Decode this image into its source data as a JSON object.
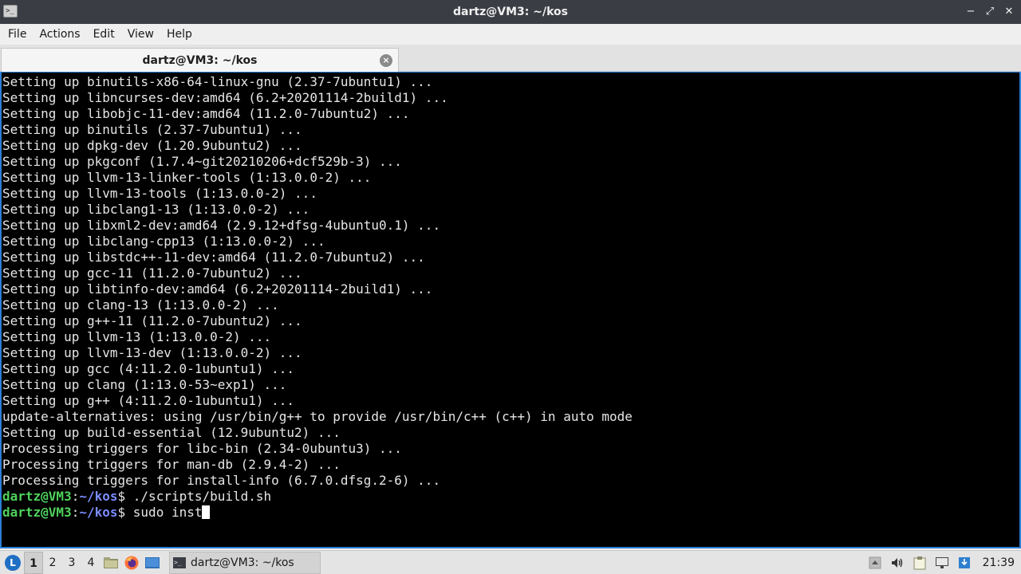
{
  "window": {
    "title": "dartz@VM3: ~/kos",
    "minimize_glyph": "−",
    "maximize_glyph": "⤢",
    "close_glyph": "✕"
  },
  "menu": [
    "File",
    "Actions",
    "Edit",
    "View",
    "Help"
  ],
  "tab": {
    "label": "dartz@VM3: ~/kos",
    "close_glyph": "×"
  },
  "terminal": {
    "output_lines": [
      "Setting up binutils-x86-64-linux-gnu (2.37-7ubuntu1) ...",
      "Setting up libncurses-dev:amd64 (6.2+20201114-2build1) ...",
      "Setting up libobjc-11-dev:amd64 (11.2.0-7ubuntu2) ...",
      "Setting up binutils (2.37-7ubuntu1) ...",
      "Setting up dpkg-dev (1.20.9ubuntu2) ...",
      "Setting up pkgconf (1.7.4~git20210206+dcf529b-3) ...",
      "Setting up llvm-13-linker-tools (1:13.0.0-2) ...",
      "Setting up llvm-13-tools (1:13.0.0-2) ...",
      "Setting up libclang1-13 (1:13.0.0-2) ...",
      "Setting up libxml2-dev:amd64 (2.9.12+dfsg-4ubuntu0.1) ...",
      "Setting up libclang-cpp13 (1:13.0.0-2) ...",
      "Setting up libstdc++-11-dev:amd64 (11.2.0-7ubuntu2) ...",
      "Setting up gcc-11 (11.2.0-7ubuntu2) ...",
      "Setting up libtinfo-dev:amd64 (6.2+20201114-2build1) ...",
      "Setting up clang-13 (1:13.0.0-2) ...",
      "Setting up g++-11 (11.2.0-7ubuntu2) ...",
      "Setting up llvm-13 (1:13.0.0-2) ...",
      "Setting up llvm-13-dev (1:13.0.0-2) ...",
      "Setting up gcc (4:11.2.0-1ubuntu1) ...",
      "Setting up clang (1:13.0-53~exp1) ...",
      "Setting up g++ (4:11.2.0-1ubuntu1) ...",
      "update-alternatives: using /usr/bin/g++ to provide /usr/bin/c++ (c++) in auto mode",
      "Setting up build-essential (12.9ubuntu2) ...",
      "Processing triggers for libc-bin (2.34-0ubuntu3) ...",
      "Processing triggers for man-db (2.9.4-2) ...",
      "Processing triggers for install-info (6.7.0.dfsg.2-6) ..."
    ],
    "prompt_user": "dartz@VM3",
    "prompt_colon": ":",
    "prompt_path": "~/kos",
    "prompt_symbol": "$",
    "command_1": " ./scripts/build.sh",
    "command_2": " sudo inst"
  },
  "taskbar": {
    "workspaces": [
      "1",
      "2",
      "3",
      "4"
    ],
    "active_workspace": "1",
    "task_label": "dartz@VM3: ~/kos",
    "clock": "21:39"
  }
}
